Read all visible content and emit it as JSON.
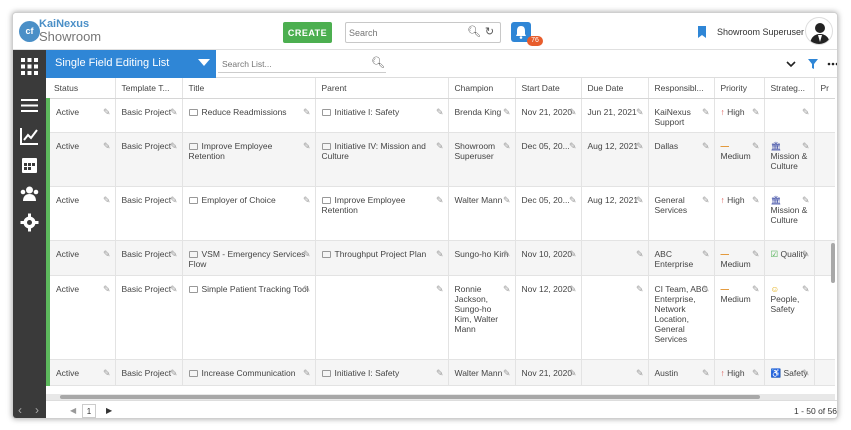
{
  "app": {
    "logo_top": "KaiNexus",
    "logo_bottom": "Showroom",
    "logo_badge": "cf",
    "create_label": "CREATE",
    "search_placeholder": "Search",
    "notification_count": "76",
    "user_name": "Showroom Superuser"
  },
  "list": {
    "title": "Single Field Editing List",
    "search_placeholder": "Search List..."
  },
  "columns": [
    "Status",
    "Template T...",
    "Title",
    "Parent",
    "Champion",
    "Start Date",
    "Due Date",
    "Responsibl...",
    "Priority",
    "Strateg...",
    "Pr"
  ],
  "rows": [
    {
      "status": "Active",
      "template": "Basic Project",
      "title": "Reduce Readmissions",
      "parent": "Initiative I: Safety",
      "champion": "Brenda King",
      "start": "Nov 21, 2020",
      "due": "Jun 21, 2021",
      "responsible": "KaiNexus Support",
      "priority": "High",
      "priority_symbol": "↑",
      "strategy": "",
      "strategy_icon": ""
    },
    {
      "status": "Active",
      "template": "Basic Project",
      "title": "Improve Employee Retention",
      "parent": "Initiative IV: Mission and Culture",
      "champion": "Showroom Superuser",
      "start": "Dec 05, 20...",
      "due": "Aug 12, 2021",
      "responsible": "Dallas",
      "priority": "Medium",
      "priority_symbol": "—",
      "strategy": "Mission & Culture",
      "strategy_icon": "🏛"
    },
    {
      "status": "Active",
      "template": "Basic Project",
      "title": "Employer of Choice",
      "parent": "Improve Employee Retention",
      "champion": "Walter Mann",
      "start": "Dec 05, 20...",
      "due": "Aug 12, 2021",
      "responsible": "General Services",
      "priority": "High",
      "priority_symbol": "↑",
      "strategy": "Mission & Culture",
      "strategy_icon": "🏛"
    },
    {
      "status": "Active",
      "template": "Basic Project",
      "title": "VSM - Emergency Services Flow",
      "parent": "Throughput Project Plan",
      "champion": "Sungo-ho Kim",
      "start": "Nov 10, 2020",
      "due": "",
      "responsible": "ABC Enterprise",
      "priority": "Medium",
      "priority_symbol": "—",
      "strategy": "Quality",
      "strategy_icon": "☑"
    },
    {
      "status": "Active",
      "template": "Basic Project",
      "title": "Simple Patient Tracking Tool",
      "parent": "",
      "champion": "Ronnie Jackson, Sungo-ho Kim, Walter Mann",
      "start": "Nov 12, 2020",
      "due": "",
      "responsible": "CI Team, ABC Enterprise, Network Location, General Services",
      "priority": "Medium",
      "priority_symbol": "—",
      "strategy": "People, Safety",
      "strategy_icon": "☺"
    },
    {
      "status": "Active",
      "template": "Basic Project",
      "title": "Increase Communication",
      "parent": "Initiative I: Safety",
      "champion": "Walter Mann",
      "start": "Nov 21, 2020",
      "due": "",
      "responsible": "Austin",
      "priority": "High",
      "priority_symbol": "↑",
      "strategy": "Safety",
      "strategy_icon": "♿"
    }
  ],
  "footer": {
    "page": "1",
    "range": "1 - 50 of 56"
  },
  "colors": {
    "primary": "#2f86d6",
    "create": "#4caf50",
    "sidebar": "#3a3a3a",
    "status_bar": "#5cb85c",
    "high": "#d9534f",
    "medium": "#e08a1e"
  },
  "icons": {
    "sidebar": [
      "apps-grid-icon",
      "list-icon",
      "chart-icon",
      "calendar-icon",
      "people-icon",
      "gear-icon"
    ],
    "listbar": [
      "chevron-down-icon",
      "filter-icon",
      "more-icon"
    ]
  }
}
